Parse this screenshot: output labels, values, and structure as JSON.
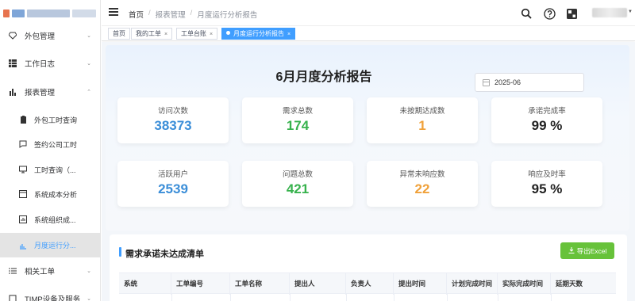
{
  "sidebar": {
    "items": [
      {
        "label": "外包管理",
        "icon": "diamond-icon",
        "chevron": "⌄"
      },
      {
        "label": "工作日志",
        "icon": "grid-icon",
        "chevron": "⌄"
      },
      {
        "label": "报表管理",
        "icon": "bar-chart-icon",
        "chevron": "⌃"
      },
      {
        "label": "外包工时查询",
        "icon": "clipboard-icon"
      },
      {
        "label": "签约公司工时",
        "icon": "chat-icon"
      },
      {
        "label": "工时查询（...",
        "icon": "monitor-icon"
      },
      {
        "label": "系统成本分析",
        "icon": "window-icon"
      },
      {
        "label": "系统组织成...",
        "icon": "chart-box-icon"
      },
      {
        "label": "月度运行分...",
        "icon": "edit-chart-icon"
      },
      {
        "label": "相关工单",
        "icon": "list-icon",
        "chevron": "⌄"
      },
      {
        "label": "TIMP设备及服务",
        "icon": "device-icon",
        "chevron": "⌄"
      }
    ]
  },
  "header": {
    "breadcrumb": [
      "首页",
      "报表管理",
      "月度运行分析报告"
    ],
    "separator": "/"
  },
  "tags": [
    {
      "label": "首页",
      "closable": false
    },
    {
      "label": "我的工单",
      "closable": true
    },
    {
      "label": "工单台账",
      "closable": true
    },
    {
      "label": "月度运行分析报告",
      "closable": true,
      "active": true
    }
  ],
  "tag_close": "×",
  "report": {
    "title": "6月月度分析报告",
    "date": "2025-06"
  },
  "cards": [
    {
      "label": "访问次数",
      "value": "38373",
      "color": "#3b8ed8"
    },
    {
      "label": "需求总数",
      "value": "174",
      "color": "#37b24d"
    },
    {
      "label": "未按期达成数",
      "value": "1",
      "color": "#f0a13a"
    },
    {
      "label": "承诺完成率",
      "value": "99 %",
      "color": "#222222"
    },
    {
      "label": "活跃用户",
      "value": "2539",
      "color": "#3b8ed8"
    },
    {
      "label": "问题总数",
      "value": "421",
      "color": "#37b24d"
    },
    {
      "label": "异常未响应数",
      "value": "22",
      "color": "#f0a13a"
    },
    {
      "label": "响应及时率",
      "value": "95 %",
      "color": "#222222"
    }
  ],
  "list": {
    "title": "需求承诺未达成清单",
    "export_label": "导出Excel",
    "columns": [
      "系统",
      "工单编号",
      "工单名称",
      "提出人",
      "负责人",
      "提出时间",
      "计划完成时间",
      "实际完成时间",
      "延期天数"
    ]
  },
  "colors": {
    "accent": "#409eff",
    "export": "#67c23a"
  }
}
